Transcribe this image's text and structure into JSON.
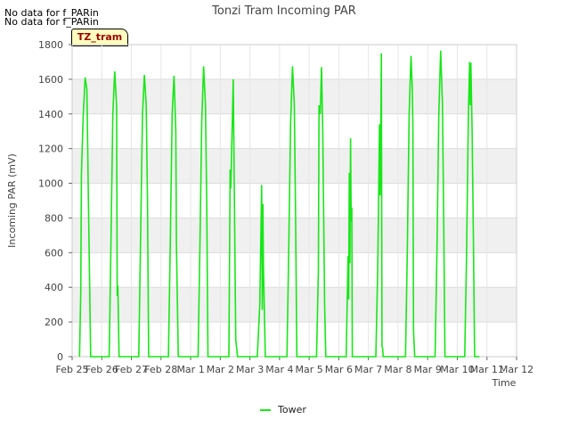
{
  "nodata_lines": [
    "No data for f_PARin",
    "No data for f_PARin"
  ],
  "site_tag": "TZ_tram",
  "chart_data": {
    "type": "line",
    "title": "Tonzi Tram Incoming PAR",
    "xlabel": "Time",
    "ylabel": "Incoming PAR (mV)",
    "xlim": [
      "Feb 25",
      "Mar 12"
    ],
    "ylim": [
      0,
      1800
    ],
    "x_ticks": [
      "Feb 25",
      "Feb 26",
      "Feb 27",
      "Feb 28",
      "Mar 1",
      "Mar 2",
      "Mar 3",
      "Mar 4",
      "Mar 5",
      "Mar 6",
      "Mar 7",
      "Mar 8",
      "Mar 9",
      "Mar 10",
      "Mar 11",
      "Mar 12"
    ],
    "y_ticks": [
      0,
      200,
      400,
      600,
      800,
      1000,
      1200,
      1400,
      1600,
      1800
    ],
    "grid": true,
    "legend_position": "bottom-center",
    "series": [
      {
        "name": "Tower",
        "color": "#19e619",
        "points": [
          [
            "Feb 25 06:00",
            0
          ],
          [
            "Feb 25 07:00",
            380
          ],
          [
            "Feb 25 07:30",
            1050
          ],
          [
            "Feb 25 09:00",
            1400
          ],
          [
            "Feb 25 10:30",
            1610
          ],
          [
            "Feb 25 12:00",
            1540
          ],
          [
            "Feb 25 13:00",
            1000
          ],
          [
            "Feb 25 15:00",
            0
          ],
          [
            "Feb 26 06:00",
            0
          ],
          [
            "Feb 26 07:30",
            700
          ],
          [
            "Feb 26 09:00",
            1400
          ],
          [
            "Feb 26 10:30",
            1645
          ],
          [
            "Feb 26 12:00",
            1450
          ],
          [
            "Feb 26 12:30",
            350
          ],
          [
            "Feb 26 13:00",
            410
          ],
          [
            "Feb 26 14:00",
            0
          ],
          [
            "Feb 27 06:00",
            0
          ],
          [
            "Feb 27 07:30",
            700
          ],
          [
            "Feb 27 09:00",
            1400
          ],
          [
            "Feb 27 10:30",
            1625
          ],
          [
            "Feb 27 12:00",
            1450
          ],
          [
            "Feb 27 13:00",
            900
          ],
          [
            "Feb 27 14:00",
            0
          ],
          [
            "Feb 28 06:00",
            0
          ],
          [
            "Feb 28 07:30",
            650
          ],
          [
            "Feb 28 09:00",
            1400
          ],
          [
            "Feb 28 10:30",
            1620
          ],
          [
            "Feb 28 12:00",
            1300
          ],
          [
            "Feb 28 12:30",
            650
          ],
          [
            "Feb 28 14:00",
            0
          ],
          [
            "Mar 1 06:00",
            0
          ],
          [
            "Mar 1 07:30",
            650
          ],
          [
            "Mar 1 09:00",
            1350
          ],
          [
            "Mar 1 10:30",
            1675
          ],
          [
            "Mar 1 12:00",
            1450
          ],
          [
            "Mar 1 13:00",
            900
          ],
          [
            "Mar 1 14:00",
            0
          ],
          [
            "Mar 2 07:00",
            0
          ],
          [
            "Mar 2 08:00",
            1080
          ],
          [
            "Mar 2 08:30",
            970
          ],
          [
            "Mar 2 09:30",
            1280
          ],
          [
            "Mar 2 10:30",
            1600
          ],
          [
            "Mar 2 11:30",
            850
          ],
          [
            "Mar 2 12:30",
            100
          ],
          [
            "Mar 2 14:00",
            0
          ],
          [
            "Mar 3 06:00",
            0
          ],
          [
            "Mar 3 08:00",
            300
          ],
          [
            "Mar 3 09:30",
            990
          ],
          [
            "Mar 3 10:00",
            270
          ],
          [
            "Mar 3 10:30",
            880
          ],
          [
            "Mar 3 11:00",
            520
          ],
          [
            "Mar 3 12:30",
            0
          ],
          [
            "Mar 4 06:00",
            0
          ],
          [
            "Mar 4 07:30",
            650
          ],
          [
            "Mar 4 09:00",
            1350
          ],
          [
            "Mar 4 10:30",
            1675
          ],
          [
            "Mar 4 12:00",
            1450
          ],
          [
            "Mar 4 13:00",
            800
          ],
          [
            "Mar 4 14:00",
            0
          ],
          [
            "Mar 5 06:00",
            0
          ],
          [
            "Mar 5 07:30",
            500
          ],
          [
            "Mar 5 08:00",
            1450
          ],
          [
            "Mar 5 09:00",
            1400
          ],
          [
            "Mar 5 10:00",
            1670
          ],
          [
            "Mar 5 11:00",
            1300
          ],
          [
            "Mar 5 12:30",
            300
          ],
          [
            "Mar 5 13:30",
            0
          ],
          [
            "Mar 6 06:00",
            0
          ],
          [
            "Mar 6 07:30",
            580
          ],
          [
            "Mar 6 08:00",
            330
          ],
          [
            "Mar 6 08:30",
            1060
          ],
          [
            "Mar 6 09:00",
            540
          ],
          [
            "Mar 6 09:30",
            1260
          ],
          [
            "Mar 6 10:00",
            780
          ],
          [
            "Mar 6 10:30",
            860
          ],
          [
            "Mar 6 11:00",
            0
          ],
          [
            "Mar 7 06:00",
            0
          ],
          [
            "Mar 7 07:30",
            500
          ],
          [
            "Mar 7 09:00",
            1340
          ],
          [
            "Mar 7 09:30",
            930
          ],
          [
            "Mar 7 10:00",
            1250
          ],
          [
            "Mar 7 10:30",
            1750
          ],
          [
            "Mar 7 11:00",
            60
          ],
          [
            "Mar 7 11:30",
            50
          ],
          [
            "Mar 7 12:00",
            0
          ],
          [
            "Mar 8 06:00",
            0
          ],
          [
            "Mar 8 07:30",
            600
          ],
          [
            "Mar 8 09:00",
            1400
          ],
          [
            "Mar 8 10:30",
            1735
          ],
          [
            "Mar 8 11:30",
            1550
          ],
          [
            "Mar 8 12:00",
            1340
          ],
          [
            "Mar 8 12:30",
            150
          ],
          [
            "Mar 8 13:30",
            0
          ],
          [
            "Mar 9 06:00",
            0
          ],
          [
            "Mar 9 07:30",
            600
          ],
          [
            "Mar 9 09:00",
            1400
          ],
          [
            "Mar 9 10:30",
            1765
          ],
          [
            "Mar 9 12:00",
            1450
          ],
          [
            "Mar 9 13:00",
            800
          ],
          [
            "Mar 9 14:00",
            0
          ],
          [
            "Mar 10 06:00",
            0
          ],
          [
            "Mar 10 07:30",
            600
          ],
          [
            "Mar 10 09:00",
            1400
          ],
          [
            "Mar 10 10:00",
            1700
          ],
          [
            "Mar 10 10:30",
            1450
          ],
          [
            "Mar 10 11:00",
            1695
          ],
          [
            "Mar 10 12:00",
            1300
          ],
          [
            "Mar 10 13:00",
            700
          ],
          [
            "Mar 10 14:00",
            0
          ],
          [
            "Mar 10 18:00",
            0
          ]
        ]
      }
    ]
  }
}
